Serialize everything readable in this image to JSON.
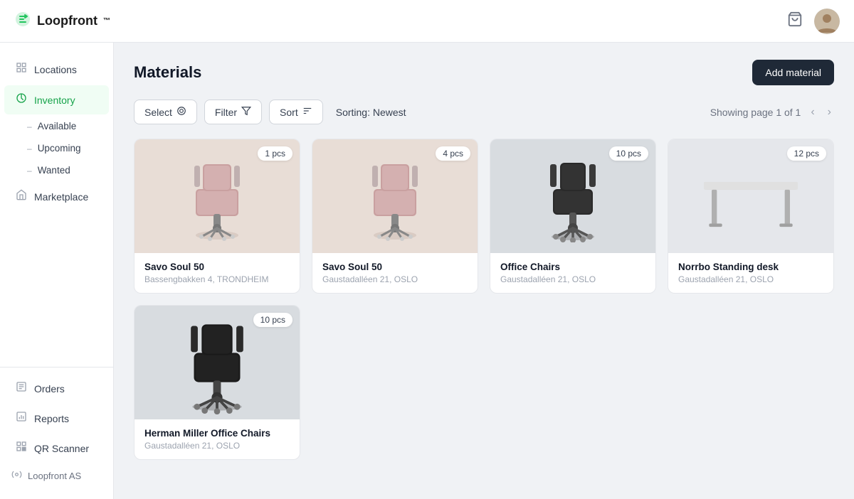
{
  "header": {
    "logo_text": "Loopfront",
    "logo_superscript": "™"
  },
  "sidebar": {
    "items": [
      {
        "id": "locations",
        "label": "Locations",
        "icon": "🏢"
      },
      {
        "id": "inventory",
        "label": "Inventory",
        "icon": "📦",
        "active": true
      },
      {
        "id": "marketplace",
        "label": "Marketplace",
        "icon": "🛍️"
      }
    ],
    "sub_items": [
      {
        "id": "available",
        "label": "Available"
      },
      {
        "id": "upcoming",
        "label": "Upcoming"
      },
      {
        "id": "wanted",
        "label": "Wanted"
      }
    ],
    "bottom_items": [
      {
        "id": "orders",
        "label": "Orders",
        "icon": "📋"
      },
      {
        "id": "reports",
        "label": "Reports",
        "icon": "📊"
      },
      {
        "id": "qr-scanner",
        "label": "QR Scanner",
        "icon": "⚡"
      }
    ],
    "brand": "Loopfront AS",
    "brand_icon": "⚙️"
  },
  "content": {
    "page_title": "Materials",
    "add_button_label": "Add material",
    "toolbar": {
      "select_label": "Select",
      "filter_label": "Filter",
      "sort_label": "Sort",
      "sorting_prefix": "Sorting:",
      "sorting_value": "Newest"
    },
    "pagination": {
      "info": "Showing page 1 of 1"
    },
    "products": [
      {
        "id": "p1",
        "name": "Savo Soul 50",
        "location": "Bassengbakken 4, TRONDHEIM",
        "quantity": "1 pcs",
        "bg_color": "#e8ddd6",
        "type": "pink-chair"
      },
      {
        "id": "p2",
        "name": "Savo Soul 50",
        "location": "Gaustadalléen 21, OSLO",
        "quantity": "4 pcs",
        "bg_color": "#e8ddd6",
        "type": "pink-chair"
      },
      {
        "id": "p3",
        "name": "Office Chairs",
        "location": "Gaustadalléen 21, OSLO",
        "quantity": "10 pcs",
        "bg_color": "#d1d5db",
        "type": "black-chair"
      },
      {
        "id": "p4",
        "name": "Norrbo Standing desk",
        "location": "Gaustadalléen 21, OSLO",
        "quantity": "12 pcs",
        "bg_color": "#e5e7eb",
        "type": "desk"
      },
      {
        "id": "p5",
        "name": "Herman Miller Office Chairs",
        "location": "Gaustadalléen 21, OSLO",
        "quantity": "10 pcs",
        "bg_color": "#d1d5db",
        "type": "black-chair"
      }
    ]
  }
}
